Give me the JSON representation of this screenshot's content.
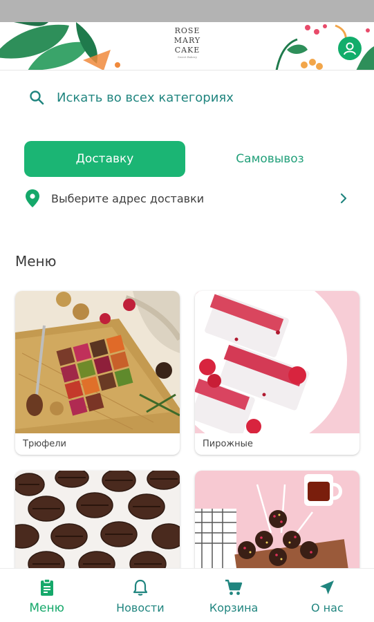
{
  "brand": {
    "line1": "ROSE",
    "line2": "MARY",
    "line3": "CAKE",
    "tagline": "Sweet Bakery"
  },
  "search": {
    "placeholder": "Искать во всех категориях"
  },
  "delivery_toggle": {
    "delivery_label": "Доставку",
    "pickup_label": "Самовывоз",
    "selected": "delivery"
  },
  "address": {
    "label": "Выберите адрес доставки"
  },
  "menu": {
    "title": "Меню",
    "categories": [
      {
        "label": "Трюфели",
        "image": "truffles"
      },
      {
        "label": "Пирожные",
        "image": "cakes"
      },
      {
        "label": "",
        "image": "chocolate-beans"
      },
      {
        "label": "",
        "image": "cake-pops"
      }
    ]
  },
  "bottom_nav": {
    "items": [
      {
        "label": "Меню",
        "icon": "clipboard-icon",
        "active": true
      },
      {
        "label": "Новости",
        "icon": "bell-icon",
        "active": false
      },
      {
        "label": "Корзина",
        "icon": "cart-icon",
        "active": false
      },
      {
        "label": "О нас",
        "icon": "navigation-arrow-icon",
        "active": false
      }
    ]
  },
  "colors": {
    "accent": "#1bb574",
    "teal_text": "#20857f",
    "status_bar": "#b3b3b3"
  }
}
